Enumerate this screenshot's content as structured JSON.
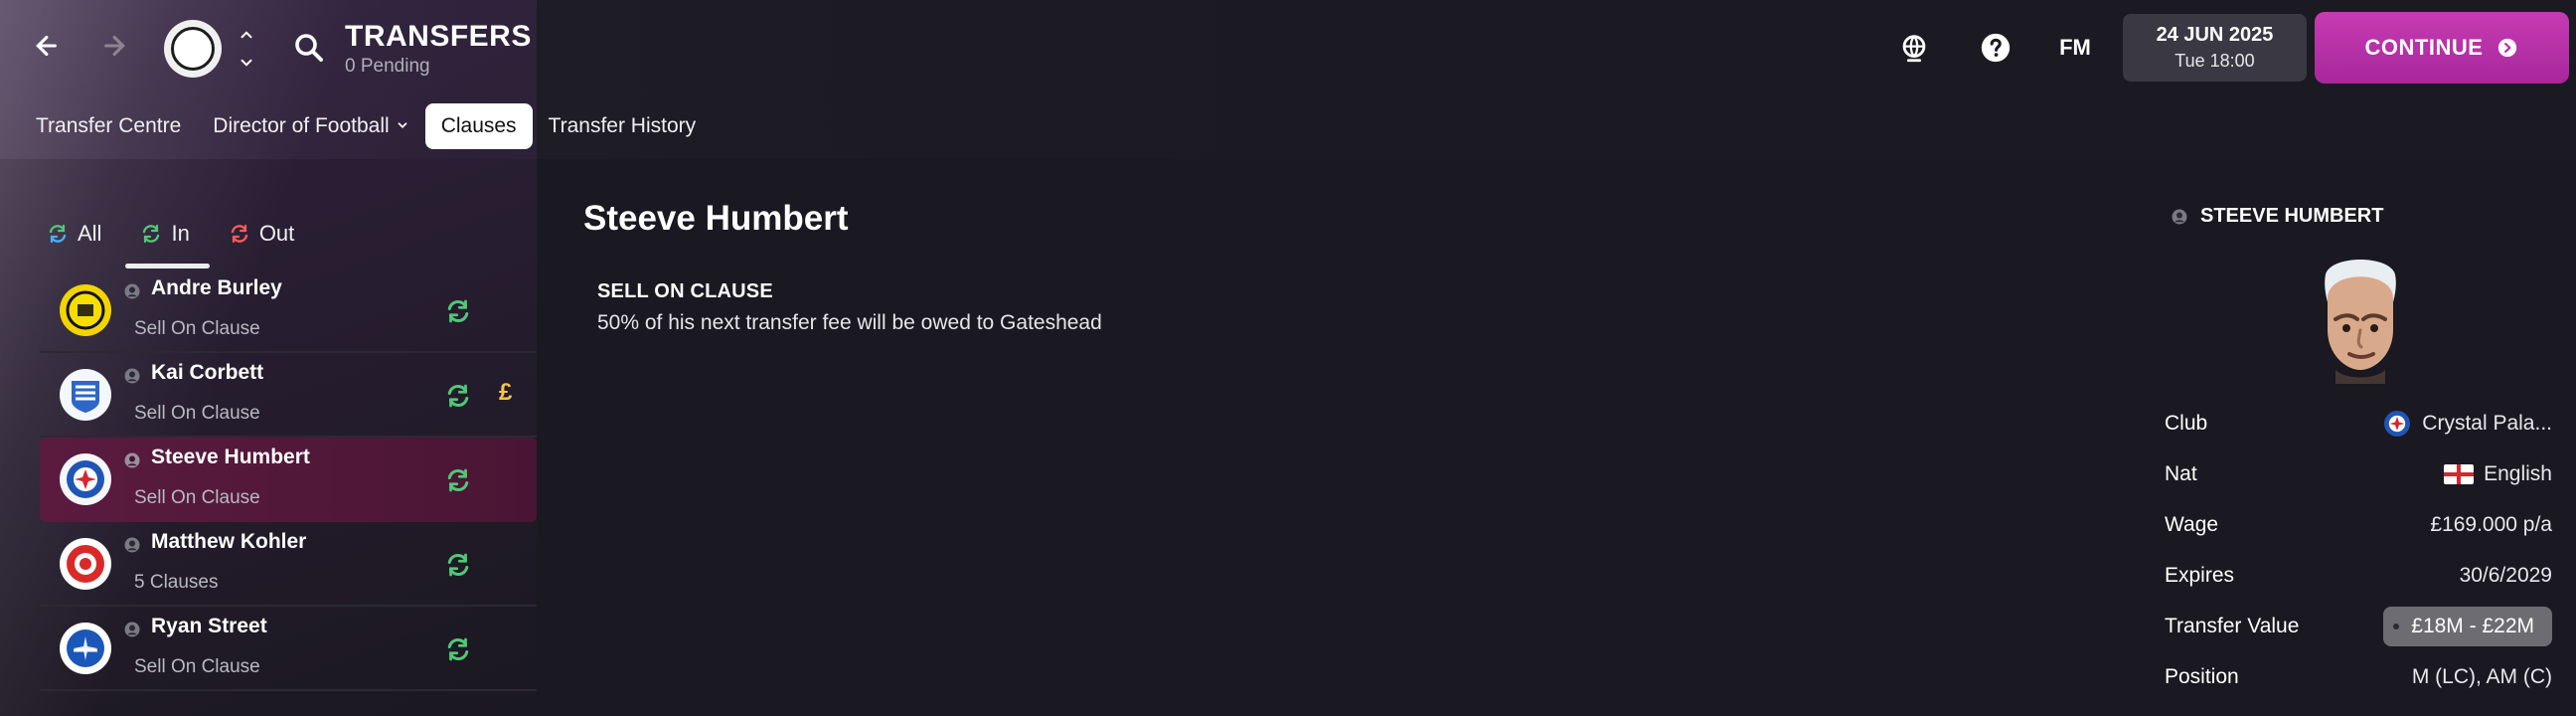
{
  "header": {
    "title": "TRANSFERS",
    "subtitle": "0 Pending",
    "fm_label": "FM",
    "date": "24 JUN 2025",
    "time": "Tue 18:00",
    "continue_label": "CONTINUE"
  },
  "tabs": [
    {
      "label": "Transfer Centre",
      "active": false
    },
    {
      "label": "Director of Football",
      "active": false
    },
    {
      "label": "Clauses",
      "active": true
    },
    {
      "label": "Transfer History",
      "active": false
    }
  ],
  "filters": [
    {
      "label": "All",
      "active": false
    },
    {
      "label": "In",
      "active": true
    },
    {
      "label": "Out",
      "active": false
    }
  ],
  "clauses_list": [
    {
      "name": "Andre Burley",
      "sub": "Sell On Clause",
      "pound": false,
      "selected": false
    },
    {
      "name": "Kai Corbett",
      "sub": "Sell On Clause",
      "pound": true,
      "pound_symbol": "£",
      "selected": false
    },
    {
      "name": "Steeve Humbert",
      "sub": "Sell On Clause",
      "pound": false,
      "selected": true
    },
    {
      "name": "Matthew Kohler",
      "sub": "5 Clauses",
      "pound": false,
      "selected": false
    },
    {
      "name": "Ryan Street",
      "sub": "Sell On Clause",
      "pound": false,
      "selected": false
    }
  ],
  "detail": {
    "player": "Steeve Humbert",
    "clause_heading": "SELL ON CLAUSE",
    "clause_text": "50% of his next transfer fee will be owed to Gateshead"
  },
  "profile": {
    "title": "STEEVE HUMBERT",
    "club_label": "Club",
    "club_value": "Crystal Pala...",
    "nat_label": "Nat",
    "nat_value": "English",
    "wage_label": "Wage",
    "wage_value": "£169.000 p/a",
    "expires_label": "Expires",
    "expires_value": "30/6/2029",
    "transfer_value_label": "Transfer Value",
    "transfer_value": "£18M - £22M",
    "position_label": "Position",
    "position_value": "M (LC), AM (C)"
  },
  "colors": {
    "accent": "#c23bb1",
    "selected_row": "#5a1b3f",
    "swap_green": "#50c878",
    "pound_gold": "#f4c54c"
  }
}
